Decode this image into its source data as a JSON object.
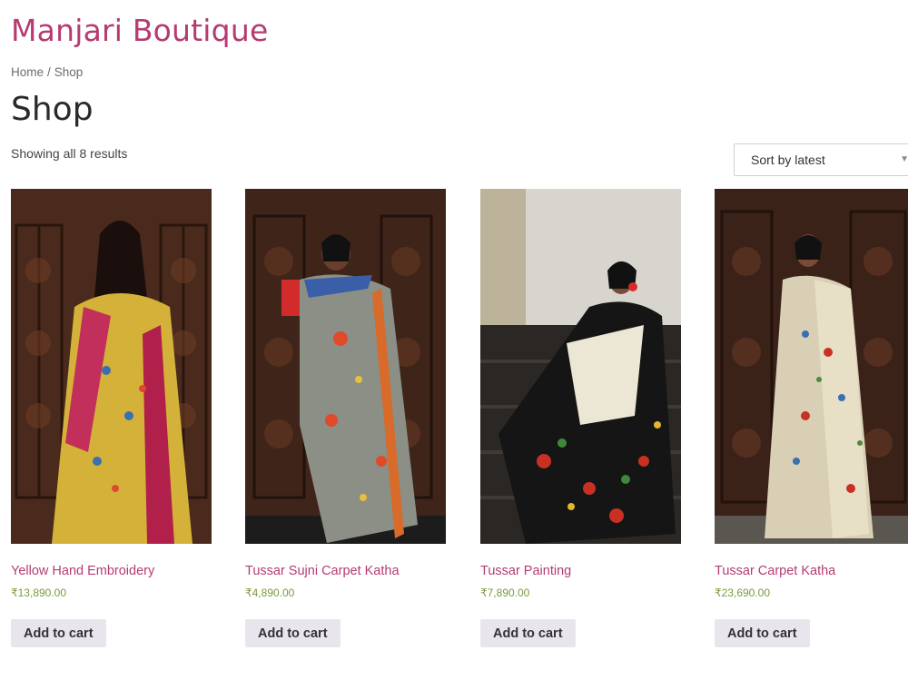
{
  "site": {
    "title": "Manjari Boutique"
  },
  "breadcrumb": {
    "home": "Home",
    "separator": "/",
    "current": "Shop"
  },
  "page": {
    "title": "Shop",
    "result_count": "Showing all 8 results"
  },
  "sort": {
    "selected": "Sort by latest"
  },
  "products": [
    {
      "name": "Yellow Hand Embroidery",
      "price": "₹13,890.00",
      "button": "Add to cart"
    },
    {
      "name": "Tussar Sujni Carpet Katha",
      "price": "₹4,890.00",
      "button": "Add to cart"
    },
    {
      "name": "Tussar Painting",
      "price": "₹7,890.00",
      "button": "Add to cart"
    },
    {
      "name": "Tussar Carpet Katha",
      "price": "₹23,690.00",
      "button": "Add to cart"
    }
  ],
  "colors": {
    "brand": "#b53b72",
    "price": "#7a9a3c",
    "button_bg": "#e8e6ec"
  }
}
